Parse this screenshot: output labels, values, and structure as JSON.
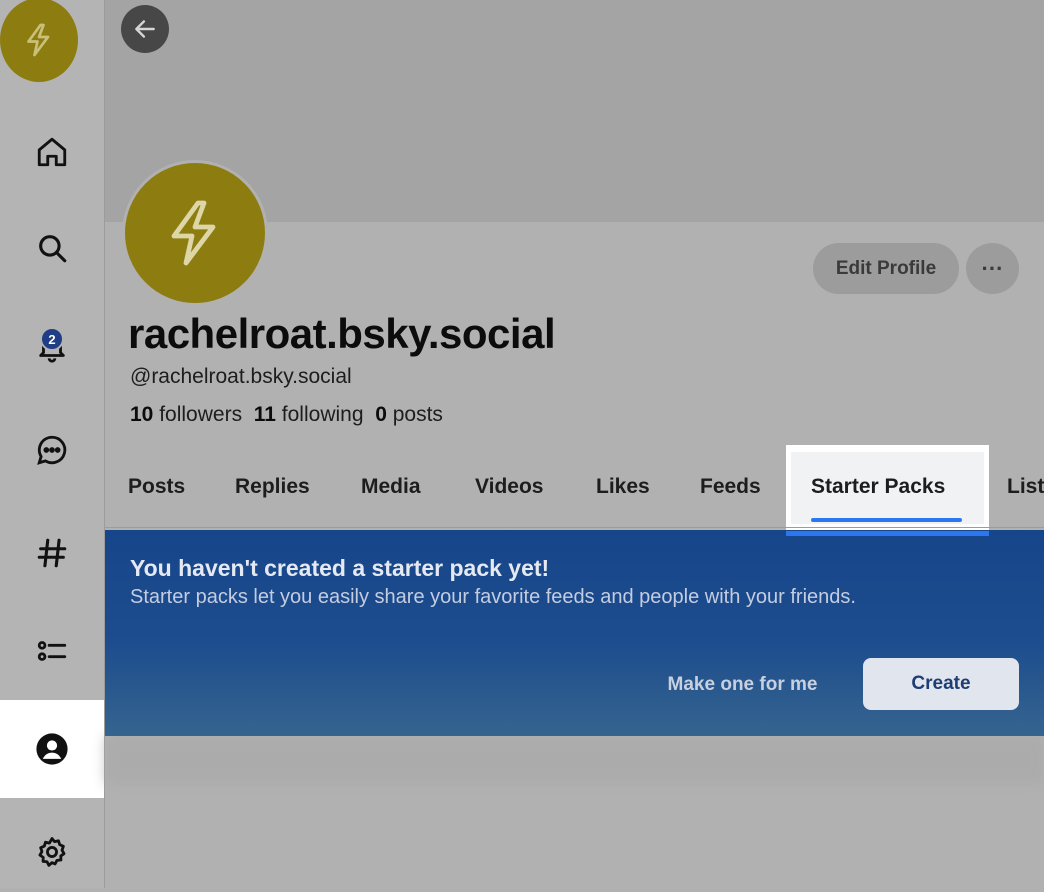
{
  "sidebar": {
    "notification_count": "2",
    "items": [
      {
        "icon": "home-icon"
      },
      {
        "icon": "search-icon"
      },
      {
        "icon": "bell-icon"
      },
      {
        "icon": "chat-icon"
      },
      {
        "icon": "hashtag-icon"
      },
      {
        "icon": "lists-icon"
      },
      {
        "icon": "profile-icon"
      },
      {
        "icon": "gear-icon"
      }
    ]
  },
  "profile": {
    "display_name": "rachelroat.bsky.social",
    "handle": "@rachelroat.bsky.social",
    "followers_count": "10",
    "followers_label": "followers",
    "following_count": "11",
    "following_label": "following",
    "posts_count": "0",
    "posts_label": "posts",
    "edit_label": "Edit Profile",
    "more_label": "···"
  },
  "tabs": [
    "Posts",
    "Replies",
    "Media",
    "Videos",
    "Likes",
    "Feeds",
    "Starter Packs",
    "Lists"
  ],
  "active_tab": "Starter Packs",
  "starter_pack": {
    "title": "You haven't created a starter pack yet!",
    "description": "Starter packs let you easily share your favorite feeds and people with your friends.",
    "make_label": "Make one for me",
    "create_label": "Create"
  },
  "colors": {
    "accent": "#2b77f0",
    "avatar": "#8d7d11",
    "card": "#1d4d8e"
  }
}
